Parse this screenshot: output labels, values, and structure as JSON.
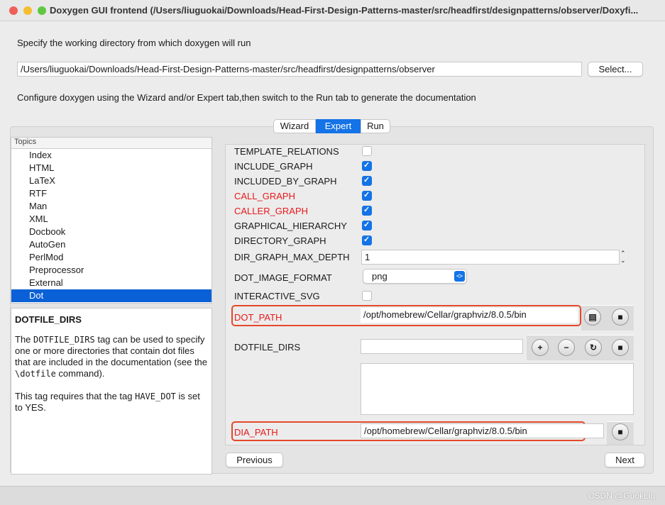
{
  "window": {
    "title": "Doxygen GUI frontend (/Users/liuguokai/Downloads/Head-First-Design-Patterns-master/src/headfirst/designpatterns/observer/Doxyfi..."
  },
  "workdir": {
    "label": "Specify the working directory from which doxygen will run",
    "value": "/Users/liuguokai/Downloads/Head-First-Design-Patterns-master/src/headfirst/designpatterns/observer",
    "select_label": "Select..."
  },
  "hint": "Configure doxygen using the Wizard and/or Expert tab,then switch to the Run tab to generate the documentation",
  "tabs": [
    {
      "label": "Wizard"
    },
    {
      "label": "Expert",
      "active": true
    },
    {
      "label": "Run"
    }
  ],
  "topics": {
    "header": "Topics",
    "items": [
      "Index",
      "HTML",
      "LaTeX",
      "RTF",
      "Man",
      "XML",
      "Docbook",
      "AutoGen",
      "PerlMod",
      "Preprocessor",
      "External",
      "Dot"
    ],
    "selected": "Dot"
  },
  "description": {
    "title": "DOTFILE_DIRS",
    "p1_a": "The ",
    "p1_code": "DOTFILE_DIRS",
    "p1_b": " tag can be used to specify one or more directories that contain dot files that are included in the documentation (see the ",
    "p1_code2": "\\dotfile",
    "p1_c": " command).",
    "p2_a": "This tag requires that the tag ",
    "p2_code": "HAVE_DOT",
    "p2_b": " is set to YES."
  },
  "options": {
    "template_relations": {
      "label": "TEMPLATE_RELATIONS",
      "checked": false
    },
    "include_graph": {
      "label": "INCLUDE_GRAPH",
      "checked": true
    },
    "included_by_graph": {
      "label": "INCLUDED_BY_GRAPH",
      "checked": true
    },
    "call_graph": {
      "label": "CALL_GRAPH",
      "checked": true
    },
    "caller_graph": {
      "label": "CALLER_GRAPH",
      "checked": true
    },
    "graphical_hierarchy": {
      "label": "GRAPHICAL_HIERARCHY",
      "checked": true
    },
    "directory_graph": {
      "label": "DIRECTORY_GRAPH",
      "checked": true
    },
    "dir_graph_max_depth": {
      "label": "DIR_GRAPH_MAX_DEPTH",
      "value": "1"
    },
    "dot_image_format": {
      "label": "DOT_IMAGE_FORMAT",
      "value": "png"
    },
    "interactive_svg": {
      "label": "INTERACTIVE_SVG",
      "checked": false
    },
    "dot_path": {
      "label": "DOT_PATH",
      "value": "/opt/homebrew/Cellar/graphviz/8.0.5/bin"
    },
    "dotfile_dirs": {
      "label": "DOTFILE_DIRS",
      "value": ""
    },
    "dia_path": {
      "label": "DIA_PATH",
      "value": "/opt/homebrew/Cellar/graphviz/8.0.5/bin"
    }
  },
  "nav": {
    "previous": "Previous",
    "next": "Next"
  },
  "watermark": "CSDN @GuokLiu",
  "colors": {
    "accent": "#1473e6",
    "modified": "#e8191b",
    "highlight": "#e5482a"
  }
}
